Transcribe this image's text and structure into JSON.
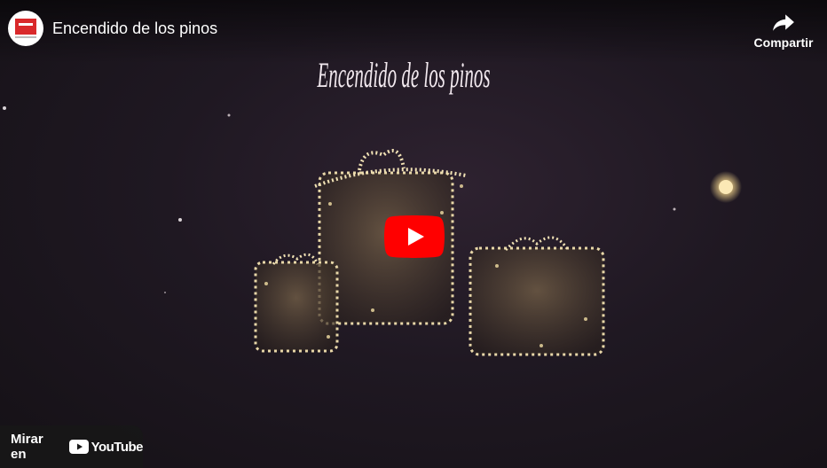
{
  "video": {
    "title": "Encendido de los pinos",
    "overlay_text": "Encendido de los pinos",
    "play_icon": "play-button-icon"
  },
  "channel": {
    "avatar_icon": "channel-logo-icon"
  },
  "share": {
    "label": "Compartir",
    "icon": "share-arrow-icon"
  },
  "watch_on": {
    "label": "Mirar en",
    "brand": "YouTube",
    "icon": "youtube-logo-icon"
  },
  "colors": {
    "play_red": "#ff0000",
    "background": "#1f1822",
    "sparkle": "#f3dfa4"
  }
}
